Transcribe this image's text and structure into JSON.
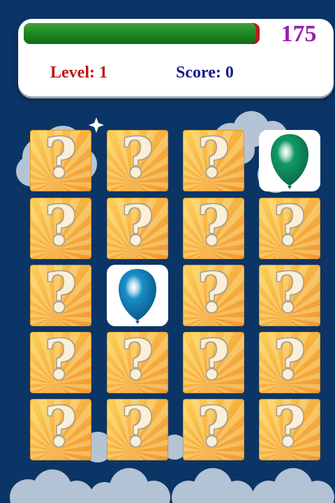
{
  "hud": {
    "timer_value": "175",
    "timer_progress": 0.985,
    "level_text": "Level: 1",
    "score_text": "Score: 0"
  },
  "colors": {
    "background": "#0b3566",
    "timer_fill": "#1f8a22",
    "timer_track": "#c4181c",
    "timer_text": "#9a1fb0",
    "level_text": "#c01414",
    "score_text": "#161f8a",
    "card_back": "#f6ae40",
    "balloon_green": "#129a66",
    "balloon_blue": "#1a8fc8"
  },
  "board": {
    "hidden_symbol": "?",
    "rows": [
      [
        {
          "state": "hidden"
        },
        {
          "state": "hidden"
        },
        {
          "state": "hidden"
        },
        {
          "state": "revealed",
          "icon": "green-balloon-icon"
        }
      ],
      [
        {
          "state": "hidden"
        },
        {
          "state": "hidden"
        },
        {
          "state": "hidden"
        },
        {
          "state": "hidden"
        }
      ],
      [
        {
          "state": "hidden"
        },
        {
          "state": "revealed",
          "icon": "blue-balloon-icon"
        },
        {
          "state": "hidden"
        },
        {
          "state": "hidden"
        }
      ],
      [
        {
          "state": "hidden"
        },
        {
          "state": "hidden"
        },
        {
          "state": "hidden"
        },
        {
          "state": "hidden"
        }
      ],
      [
        {
          "state": "hidden"
        },
        {
          "state": "hidden"
        },
        {
          "state": "hidden"
        },
        {
          "state": "hidden"
        }
      ]
    ]
  }
}
